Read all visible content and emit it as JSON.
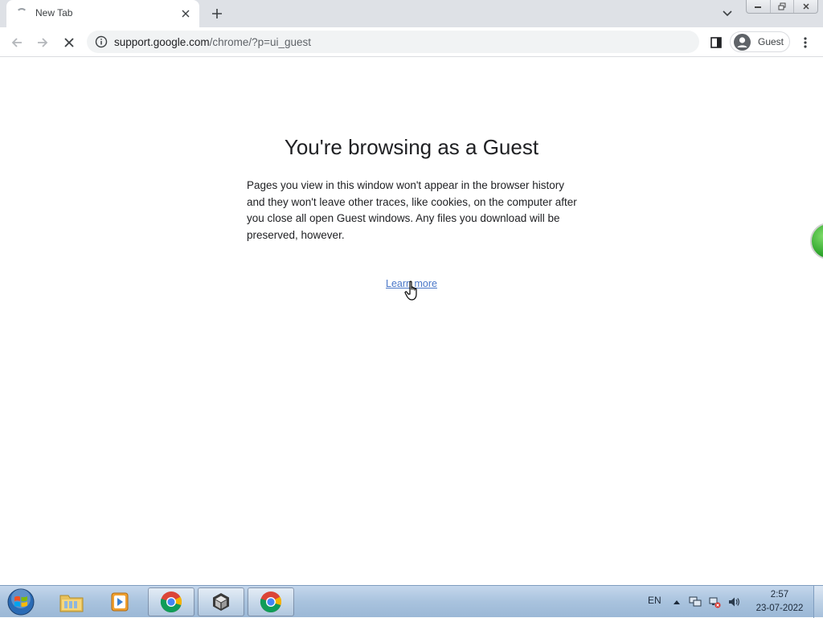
{
  "browser": {
    "tab": {
      "title": "New Tab"
    },
    "omnibox": {
      "host": "support.google.com",
      "path": "/chrome/?p=ui_guest"
    },
    "profile": {
      "label": "Guest"
    }
  },
  "page": {
    "headline": "You're browsing as a Guest",
    "body": "Pages you view in this window won't appear in the browser history and they won't leave other traces, like cookies, on the computer after you close all open Guest windows. Any files you download will be preserved, however.",
    "learn_more": "Learn more"
  },
  "taskbar": {
    "items": [
      "windows-start",
      "file-explorer",
      "media-player",
      "chrome",
      "unity",
      "chrome"
    ],
    "active_item": "chrome",
    "tray": {
      "language": "EN",
      "time": "2:57",
      "date": "23-07-2022"
    }
  },
  "colors": {
    "link": "#4a77c8",
    "tab_strip": "#dee1e6",
    "omnibox": "#f1f3f4",
    "taskbar": "#a9c3de"
  }
}
